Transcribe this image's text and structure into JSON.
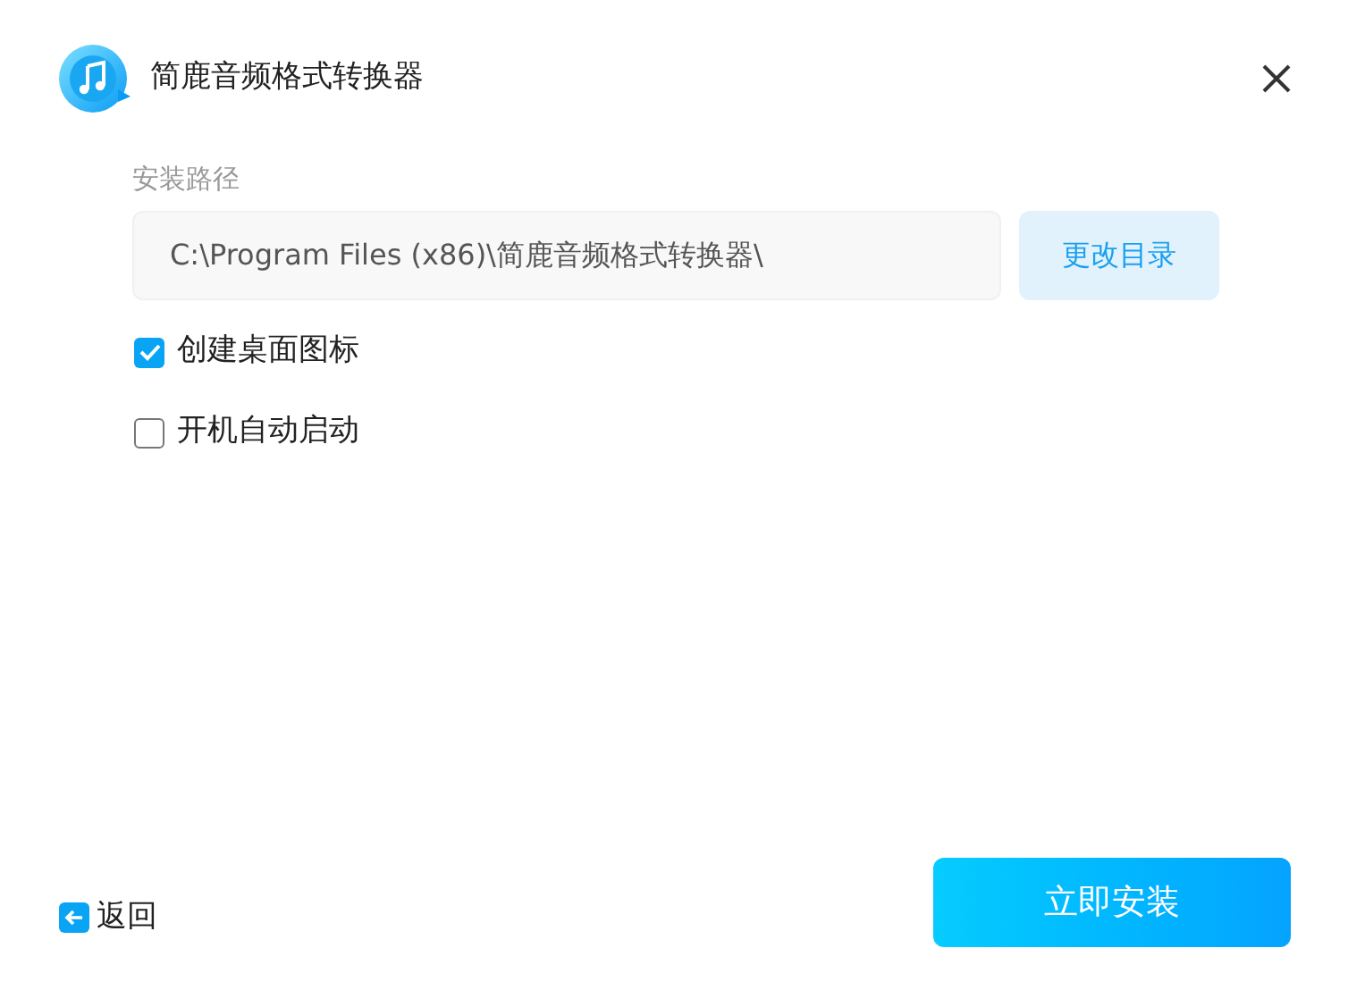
{
  "window": {
    "title": "简鹿音频格式转换器"
  },
  "install_path": {
    "label": "安装路径",
    "value": "C:\\Program Files (x86)\\简鹿音频格式转换器\\",
    "change_button": "更改目录"
  },
  "options": [
    {
      "label": "创建桌面图标",
      "checked": true
    },
    {
      "label": "开机自动启动",
      "checked": false
    }
  ],
  "back_link": "返回",
  "install_button": "立即安装"
}
